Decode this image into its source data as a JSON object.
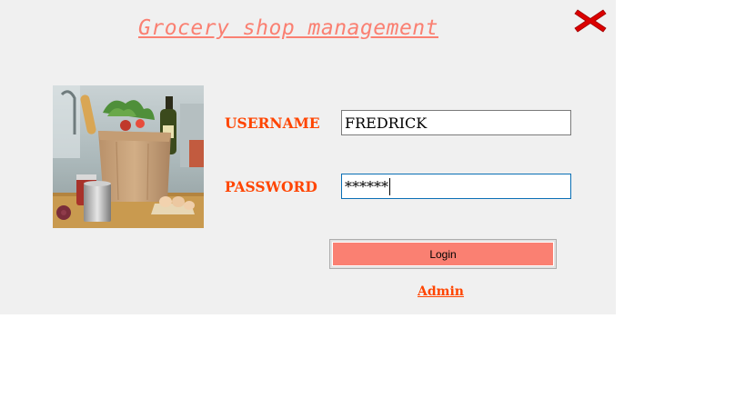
{
  "window": {
    "title": "Grocery shop management",
    "close_icon": "close-icon"
  },
  "colors": {
    "title": "#fa8072",
    "label": "#ff4500",
    "close_icon": "#dc0000",
    "login_button": "#fa8072",
    "form_background": "#f0f0f0"
  },
  "login_form": {
    "username_label": "USERNAME",
    "username_value": "FREDRICK",
    "password_label": "PASSWORD",
    "password_value": "******",
    "login_button_label": "Login",
    "admin_link_label": "Admin"
  },
  "image": {
    "icon": "grocery-bag-image"
  }
}
